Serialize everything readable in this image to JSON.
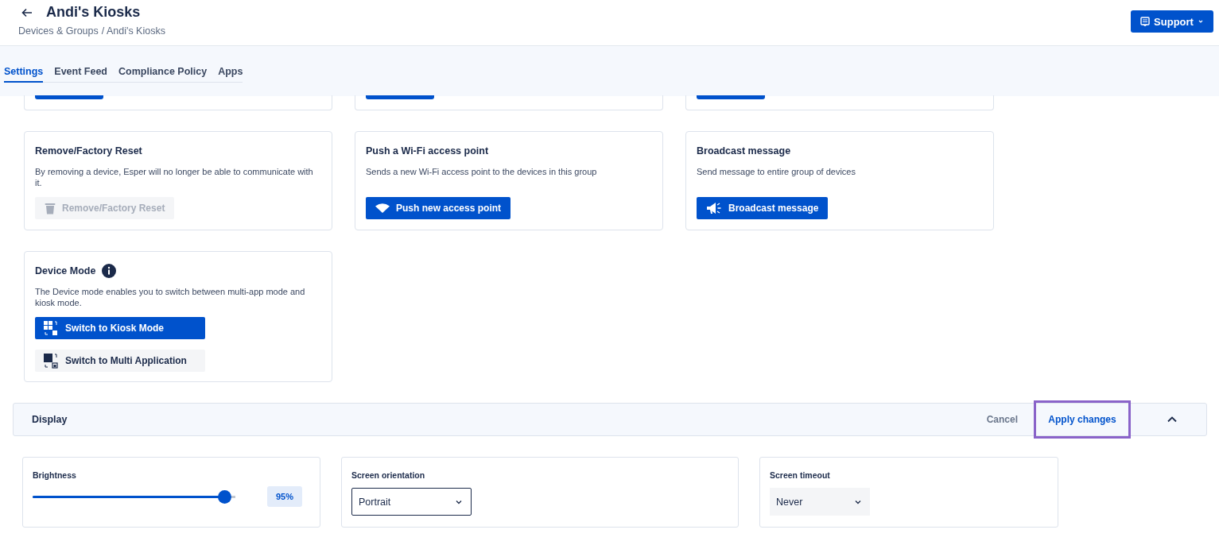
{
  "header": {
    "title": "Andi's Kiosks",
    "breadcrumbs": [
      "Devices & Groups",
      "/ Andi's Kiosks"
    ],
    "support_button": "Support"
  },
  "tabs": [
    {
      "label": "Settings",
      "selected": true
    },
    {
      "label": "Event Feed",
      "selected": false
    },
    {
      "label": "Compliance Policy",
      "selected": false
    },
    {
      "label": "Apps",
      "selected": false
    }
  ],
  "cards": [
    {
      "title": "Remove/Factory Reset",
      "info": false,
      "description": "By removing a device, Esper will no longer be able to communicate with it.",
      "buttons": [
        {
          "kind": "secondary",
          "label": "Remove/Factory Reset",
          "disabled": true
        }
      ]
    },
    {
      "title": "Push a Wi-Fi access point",
      "info": false,
      "description": "Sends a new Wi-Fi access point to the devices in this group",
      "buttons": [
        {
          "kind": "primary",
          "label": "Push new access point",
          "disabled": false
        }
      ]
    },
    {
      "title": "Broadcast message",
      "info": false,
      "description": "Send message to entire group of devices",
      "buttons": [
        {
          "kind": "primary",
          "label": "Broadcast message",
          "disabled": false
        }
      ]
    },
    {
      "title": "Device Mode",
      "info": true,
      "description": "The Device mode enables you to switch between multi-app mode and kiosk mode.",
      "buttons": [
        {
          "kind": "primary",
          "label": "Switch to Kiosk Mode",
          "disabled": false
        },
        {
          "kind": "secondary",
          "label": "Switch to Multi Application",
          "disabled": false
        }
      ]
    }
  ],
  "display": {
    "title": "Display",
    "expanded": true,
    "cancel": "Cancel",
    "apply": {
      "label": "Apply changes",
      "highlighted": true
    }
  },
  "settings": [
    {
      "kind": "slider",
      "label": "Brightness",
      "level": 0.95,
      "reading": "95%"
    },
    {
      "kind": "select",
      "label": "Screen orientation",
      "value": "Portrait",
      "outlined": true
    },
    {
      "kind": "select",
      "label": "Screen timeout",
      "value": "Never",
      "outlined": false
    }
  ]
}
